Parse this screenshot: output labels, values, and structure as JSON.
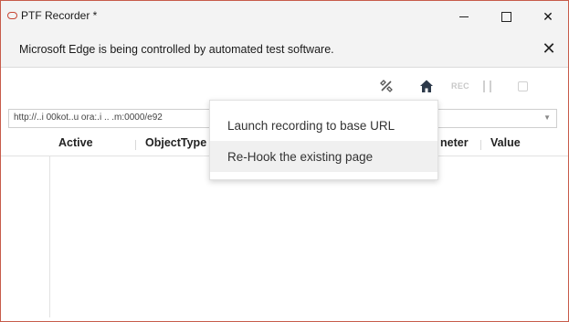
{
  "window": {
    "title": "PTF Recorder *",
    "accent_color": "#c74634"
  },
  "window_controls": {
    "minimize_icon": "minimize-icon",
    "maximize_icon": "maximize-icon",
    "close_label": "✕"
  },
  "infobar": {
    "message": "Microsoft Edge is being controlled by automated test software.",
    "close_label": "✕"
  },
  "toolbar": {
    "settings_icon": "tools-icon",
    "home_icon": "home-icon",
    "record_label": "REC",
    "pause_icon": "pause-icon",
    "stop_icon": "stop-icon"
  },
  "url": {
    "value": "http://..i 00kot..u ora:.i .. .m:0000/e92"
  },
  "table": {
    "columns": [
      "Active",
      "ObjectType",
      "Parameter",
      "Value"
    ],
    "column_labels_visible": [
      "Active",
      "ObjectType",
      "neter",
      "Value"
    ]
  },
  "dropdown": {
    "items": [
      {
        "label": "Launch recording to base URL"
      },
      {
        "label": "Re-Hook the existing page"
      }
    ]
  }
}
